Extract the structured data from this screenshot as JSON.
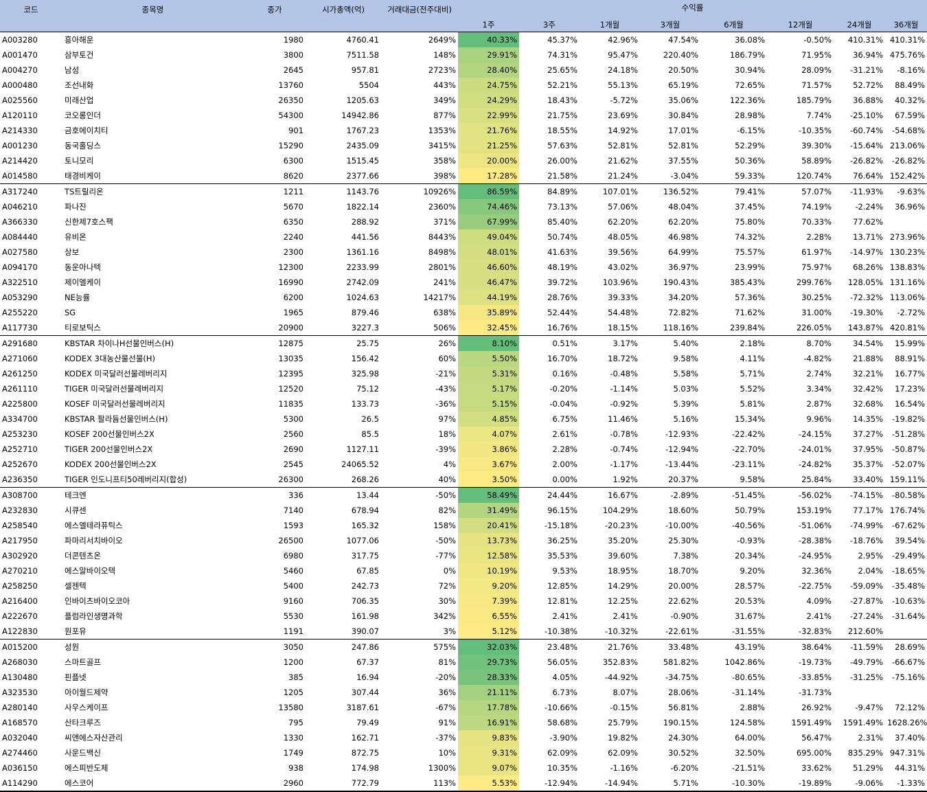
{
  "header": {
    "code": "코드",
    "name": "종목명",
    "close": "종가",
    "mcap": "시가총액(억)",
    "volume": "거래대금(전주대비)",
    "returns": "수익률",
    "periods": [
      "1주",
      "3주",
      "1개월",
      "3개월",
      "6개월",
      "12개월",
      "24개월",
      "36개월"
    ]
  },
  "colors": {
    "header_bg": "#b4c6e7",
    "scale_high": "#63be7b",
    "scale_low": "#ffeb84"
  },
  "groups": [
    {
      "rows": [
        [
          "A003280",
          "흥아해운",
          "1980",
          "4760.41",
          "2649%",
          "40.33%",
          "45.37%",
          "42.96%",
          "47.54%",
          "36.08%",
          "-0.50%",
          "410.31%",
          "410.31%"
        ],
        [
          "A001470",
          "삼부토건",
          "3800",
          "7511.58",
          "148%",
          "29.91%",
          "74.31%",
          "95.47%",
          "220.40%",
          "186.79%",
          "71.95%",
          "36.94%",
          "475.76%"
        ],
        [
          "A004270",
          "남성",
          "2645",
          "957.81",
          "2723%",
          "28.40%",
          "25.65%",
          "24.18%",
          "20.50%",
          "30.94%",
          "28.09%",
          "-31.21%",
          "-8.16%"
        ],
        [
          "A000480",
          "조선내화",
          "13760",
          "5504",
          "443%",
          "24.75%",
          "52.21%",
          "55.13%",
          "65.19%",
          "72.65%",
          "71.57%",
          "52.72%",
          "88.49%"
        ],
        [
          "A025560",
          "미래산업",
          "26350",
          "1205.63",
          "349%",
          "24.29%",
          "18.43%",
          "-5.72%",
          "35.06%",
          "122.36%",
          "185.79%",
          "36.88%",
          "40.32%"
        ],
        [
          "A120110",
          "코오롱인더",
          "54300",
          "14942.86",
          "877%",
          "22.99%",
          "21.75%",
          "23.69%",
          "30.84%",
          "28.98%",
          "7.74%",
          "-25.10%",
          "67.59%"
        ],
        [
          "A214330",
          "금호에이치티",
          "901",
          "1767.23",
          "1353%",
          "21.76%",
          "18.55%",
          "14.92%",
          "17.01%",
          "-6.15%",
          "-10.35%",
          "-60.74%",
          "-54.68%"
        ],
        [
          "A001230",
          "동국홀딩스",
          "15290",
          "2435.09",
          "3415%",
          "21.25%",
          "57.63%",
          "52.81%",
          "52.81%",
          "52.29%",
          "39.30%",
          "-15.64%",
          "213.06%"
        ],
        [
          "A214420",
          "토니모리",
          "6300",
          "1515.45",
          "358%",
          "20.00%",
          "26.00%",
          "21.62%",
          "37.55%",
          "50.36%",
          "58.89%",
          "-26.82%",
          "-26.82%"
        ],
        [
          "A014580",
          "태경비케이",
          "8620",
          "2377.66",
          "398%",
          "17.28%",
          "21.58%",
          "21.24%",
          "-3.04%",
          "59.33%",
          "120.74%",
          "76.64%",
          "152.42%"
        ]
      ]
    },
    {
      "rows": [
        [
          "A317240",
          "TS트릴리온",
          "1211",
          "1143.76",
          "10926%",
          "86.59%",
          "84.89%",
          "107.01%",
          "136.52%",
          "79.41%",
          "57.07%",
          "-11.93%",
          "-9.63%"
        ],
        [
          "A046210",
          "파나진",
          "5670",
          "1822.14",
          "2360%",
          "74.46%",
          "73.13%",
          "57.06%",
          "48.04%",
          "37.45%",
          "74.19%",
          "-2.24%",
          "36.96%"
        ],
        [
          "A366330",
          "신한제7호스팩",
          "6350",
          "288.92",
          "371%",
          "67.99%",
          "85.40%",
          "62.20%",
          "62.20%",
          "75.80%",
          "70.33%",
          "77.62%",
          ""
        ],
        [
          "A084440",
          "유비온",
          "2240",
          "441.56",
          "8443%",
          "49.04%",
          "50.74%",
          "48.05%",
          "46.98%",
          "74.32%",
          "2.28%",
          "13.71%",
          "273.96%"
        ],
        [
          "A027580",
          "상보",
          "2300",
          "1361.16",
          "8498%",
          "48.01%",
          "41.63%",
          "39.56%",
          "64.99%",
          "75.57%",
          "61.97%",
          "-14.97%",
          "130.23%"
        ],
        [
          "A094170",
          "동운아나텍",
          "12300",
          "2233.99",
          "2801%",
          "46.60%",
          "48.19%",
          "43.02%",
          "36.97%",
          "23.99%",
          "75.97%",
          "68.26%",
          "138.83%"
        ],
        [
          "A322510",
          "제이엘케이",
          "16990",
          "2742.09",
          "241%",
          "46.47%",
          "39.72%",
          "103.96%",
          "190.43%",
          "385.43%",
          "299.76%",
          "128.05%",
          "131.16%"
        ],
        [
          "A053290",
          "NE능률",
          "6200",
          "1024.63",
          "14217%",
          "44.19%",
          "28.76%",
          "39.33%",
          "34.20%",
          "57.36%",
          "30.25%",
          "-72.32%",
          "113.06%"
        ],
        [
          "A255220",
          "SG",
          "1965",
          "879.46",
          "638%",
          "35.89%",
          "52.44%",
          "54.48%",
          "72.82%",
          "71.62%",
          "31.00%",
          "-19.30%",
          "-2.72%"
        ],
        [
          "A117730",
          "티로보틱스",
          "20900",
          "3227.3",
          "506%",
          "32.45%",
          "16.76%",
          "18.15%",
          "118.16%",
          "239.84%",
          "226.05%",
          "143.87%",
          "420.81%"
        ]
      ]
    },
    {
      "rows": [
        [
          "A291680",
          "KBSTAR 차이나H선물인버스(H)",
          "12875",
          "25.75",
          "26%",
          "8.10%",
          "0.51%",
          "3.17%",
          "5.40%",
          "2.18%",
          "8.70%",
          "34.54%",
          "15.99%"
        ],
        [
          "A271060",
          "KODEX 3대농산물선물(H)",
          "13035",
          "156.42",
          "60%",
          "5.50%",
          "16.70%",
          "18.72%",
          "9.58%",
          "4.11%",
          "-4.82%",
          "21.88%",
          "88.91%"
        ],
        [
          "A261250",
          "KODEX 미국달러선물레버리지",
          "12395",
          "325.98",
          "-21%",
          "5.31%",
          "0.16%",
          "-0.48%",
          "5.58%",
          "5.71%",
          "2.74%",
          "32.21%",
          "16.77%"
        ],
        [
          "A261110",
          "TIGER 미국달러선물레버리지",
          "12520",
          "75.12",
          "-43%",
          "5.17%",
          "-0.20%",
          "-1.14%",
          "5.03%",
          "5.52%",
          "3.34%",
          "32.42%",
          "17.23%"
        ],
        [
          "A225800",
          "KOSEF 미국달러선물레버리지",
          "11835",
          "133.73",
          "-36%",
          "5.15%",
          "-0.04%",
          "-0.92%",
          "5.39%",
          "5.81%",
          "2.87%",
          "32.68%",
          "16.54%"
        ],
        [
          "A334700",
          "KBSTAR 팔라듐선물인버스(H)",
          "5300",
          "26.5",
          "97%",
          "4.85%",
          "6.75%",
          "11.46%",
          "5.16%",
          "15.34%",
          "9.96%",
          "14.35%",
          "-19.82%"
        ],
        [
          "A253230",
          "KOSEF 200선물인버스2X",
          "2560",
          "85.5",
          "18%",
          "4.07%",
          "2.61%",
          "-0.78%",
          "-12.93%",
          "-22.42%",
          "-24.15%",
          "37.27%",
          "-51.28%"
        ],
        [
          "A252710",
          "TIGER 200선물인버스2X",
          "2690",
          "1127.11",
          "-39%",
          "3.86%",
          "2.28%",
          "-0.74%",
          "-12.94%",
          "-22.70%",
          "-24.01%",
          "37.95%",
          "-50.87%"
        ],
        [
          "A252670",
          "KODEX 200선물인버스2X",
          "2545",
          "24065.52",
          "4%",
          "3.67%",
          "2.00%",
          "-1.17%",
          "-13.44%",
          "-23.11%",
          "-24.82%",
          "35.37%",
          "-52.07%"
        ],
        [
          "A236350",
          "TIGER 인도니프티50레버리지(합성)",
          "26300",
          "268.26",
          "40%",
          "3.50%",
          "0.00%",
          "1.92%",
          "20.37%",
          "9.58%",
          "25.84%",
          "33.40%",
          "159.11%"
        ]
      ]
    },
    {
      "rows": [
        [
          "A308700",
          "테크엔",
          "336",
          "13.44",
          "-50%",
          "58.49%",
          "24.44%",
          "16.67%",
          "-2.89%",
          "-51.45%",
          "-56.02%",
          "-74.15%",
          "-80.58%"
        ],
        [
          "A232830",
          "시큐센",
          "7140",
          "678.94",
          "82%",
          "31.49%",
          "96.15%",
          "104.29%",
          "18.60%",
          "50.79%",
          "153.19%",
          "77.17%",
          "176.74%"
        ],
        [
          "A258540",
          "에스엘테라퓨틱스",
          "1593",
          "165.32",
          "158%",
          "20.41%",
          "-15.18%",
          "-20.23%",
          "-10.00%",
          "-40.56%",
          "-51.06%",
          "-74.99%",
          "-67.62%"
        ],
        [
          "A217950",
          "파마리서치바이오",
          "26500",
          "1077.06",
          "-50%",
          "13.73%",
          "36.25%",
          "35.20%",
          "25.30%",
          "-0.93%",
          "-28.38%",
          "-18.76%",
          "39.54%"
        ],
        [
          "A302920",
          "더콘텐츠온",
          "6980",
          "317.75",
          "-77%",
          "12.58%",
          "35.53%",
          "39.60%",
          "7.38%",
          "20.34%",
          "-24.95%",
          "2.95%",
          "-29.49%"
        ],
        [
          "A270210",
          "에스알바이오텍",
          "5460",
          "67.85",
          "0%",
          "10.19%",
          "9.53%",
          "18.95%",
          "18.70%",
          "9.20%",
          "32.36%",
          "2.04%",
          "-18.65%"
        ],
        [
          "A258250",
          "셀젠텍",
          "5400",
          "242.73",
          "72%",
          "9.20%",
          "12.85%",
          "14.29%",
          "20.00%",
          "28.57%",
          "-22.75%",
          "-59.09%",
          "-35.48%"
        ],
        [
          "A216400",
          "인바이츠바이오코아",
          "9160",
          "706.35",
          "30%",
          "7.39%",
          "12.81%",
          "12.25%",
          "22.62%",
          "20.53%",
          "4.09%",
          "-27.87%",
          "-10.63%"
        ],
        [
          "A222670",
          "플럼라인생명과학",
          "5530",
          "161.98",
          "342%",
          "6.55%",
          "2.41%",
          "2.41%",
          "-0.90%",
          "31.67%",
          "2.41%",
          "-27.24%",
          "-31.64%"
        ],
        [
          "A122830",
          "원포유",
          "1191",
          "390.07",
          "3%",
          "5.12%",
          "-10.38%",
          "-10.32%",
          "-22.61%",
          "-31.55%",
          "-32.83%",
          "212.60%",
          ""
        ]
      ]
    },
    {
      "rows": [
        [
          "A015200",
          "성원",
          "3050",
          "247.86",
          "575%",
          "32.03%",
          "23.48%",
          "21.76%",
          "33.48%",
          "43.19%",
          "38.64%",
          "-11.59%",
          "28.69%"
        ],
        [
          "A268030",
          "스마트골프",
          "1200",
          "67.37",
          "81%",
          "29.73%",
          "56.05%",
          "352.83%",
          "581.82%",
          "1042.86%",
          "-19.73%",
          "-49.79%",
          "-66.67%"
        ],
        [
          "A130480",
          "핀플넷",
          "385",
          "16.94",
          "-20%",
          "28.33%",
          "4.05%",
          "-44.92%",
          "-34.75%",
          "-80.65%",
          "-33.85%",
          "-31.25%",
          "-75.16%"
        ],
        [
          "A323530",
          "아이월드제약",
          "1205",
          "307.44",
          "36%",
          "21.11%",
          "6.73%",
          "8.07%",
          "28.06%",
          "-31.14%",
          "-31.73%",
          "",
          ""
        ],
        [
          "A280140",
          "사우스케이프",
          "13580",
          "3187.61",
          "-67%",
          "17.78%",
          "-10.66%",
          "-0.15%",
          "56.81%",
          "2.88%",
          "26.92%",
          "-9.47%",
          "72.12%"
        ],
        [
          "A168570",
          "산타크루즈",
          "795",
          "79.49",
          "91%",
          "16.91%",
          "58.68%",
          "25.79%",
          "190.15%",
          "124.58%",
          "1591.49%",
          "1591.49%",
          "1628.26%"
        ],
        [
          "A032040",
          "씨앤에스자산관리",
          "1330",
          "162.71",
          "-37%",
          "9.83%",
          "-3.90%",
          "19.82%",
          "24.30%",
          "64.00%",
          "56.47%",
          "2.31%",
          "37.40%"
        ],
        [
          "A274460",
          "사운드백신",
          "1749",
          "872.75",
          "10%",
          "9.31%",
          "62.09%",
          "62.09%",
          "30.52%",
          "32.50%",
          "695.00%",
          "835.29%",
          "947.31%"
        ],
        [
          "A036150",
          "에스피반도체",
          "938",
          "174.98",
          "1300%",
          "9.07%",
          "10.35%",
          "-1.16%",
          "-6.20%",
          "-21.51%",
          "33.62%",
          "51.29%",
          "44.31%"
        ],
        [
          "A114290",
          "에스코어",
          "2960",
          "772.79",
          "113%",
          "5.53%",
          "-12.94%",
          "-14.94%",
          "5.71%",
          "-10.30%",
          "-19.89%",
          "-9.06%",
          "-1.33%"
        ]
      ]
    }
  ]
}
